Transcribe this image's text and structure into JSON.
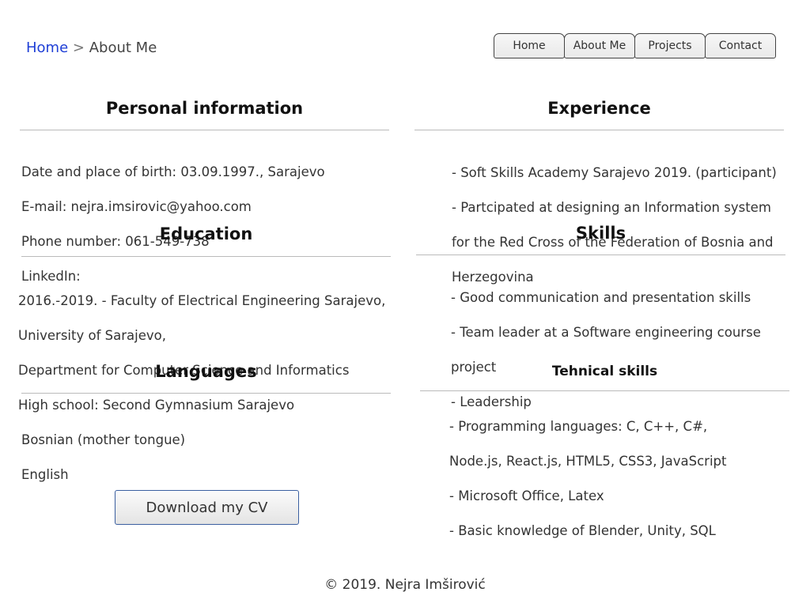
{
  "breadcrumb": {
    "home": "Home",
    "separator": ">",
    "current": "About Me"
  },
  "nav": {
    "items": [
      "Home",
      "About Me",
      "Projects",
      "Contact"
    ]
  },
  "personal": {
    "title": "Personal information",
    "lines": [
      "Date and place of birth: 03.09.1997., Sarajevo",
      "E-mail: nejra.imsirovic@yahoo.com",
      "Phone number: 061-549-738",
      "LinkedIn:"
    ]
  },
  "education": {
    "title": "Education",
    "lines": [
      "2016.-2019. - Faculty of Electrical Engineering Sarajevo,",
      "University of Sarajevo,",
      "Department for Computer Science and Informatics",
      "High school: Second Gymnasium Sarajevo"
    ]
  },
  "languages": {
    "title": "Languages",
    "lines": [
      "Bosnian (mother tongue)",
      "English"
    ]
  },
  "experience": {
    "title": "Experience",
    "lines": [
      "- Soft Skills Academy Sarajevo 2019. (participant)",
      "- Partcipated at designing an Information system",
      "for the Red Cross of the Federation of Bosnia and",
      "Herzegovina"
    ]
  },
  "skills": {
    "title": "Skills",
    "lines": [
      "- Good communication and presentation skills",
      "- Team leader at a Software engineering course",
      "project",
      "- Leadership"
    ]
  },
  "technical": {
    "title": "Tehnical skills",
    "lines": [
      "- Programming languages: C, C++, C#,",
      "Node.js, React.js, HTML5, CSS3, JavaScript",
      "- Microsoft Office, Latex",
      "- Basic knowledge of Blender, Unity, SQL"
    ]
  },
  "cv_button": {
    "label": "Download my CV"
  },
  "footer": {
    "text": "© 2019. Nejra Imširović"
  }
}
